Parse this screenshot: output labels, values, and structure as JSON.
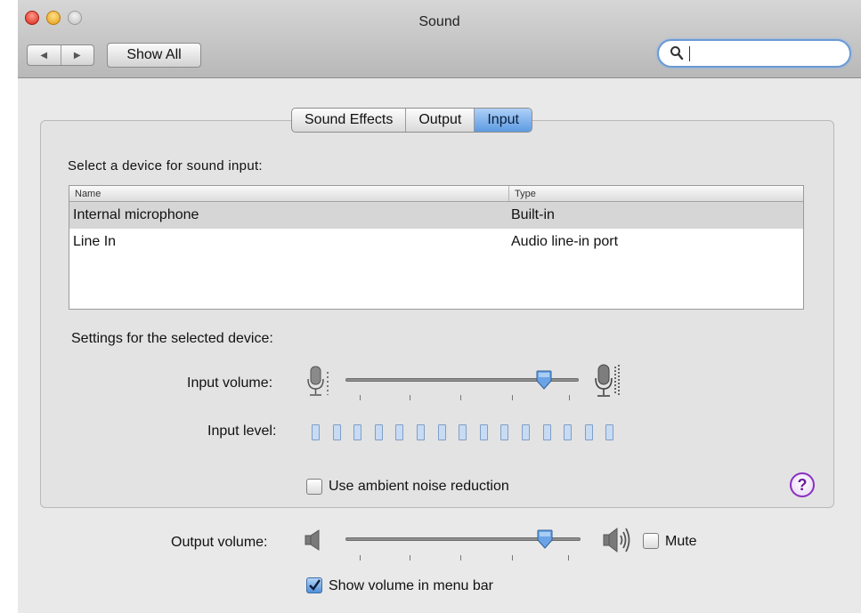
{
  "window": {
    "title": "Sound"
  },
  "toolbar": {
    "back_glyph": "◀",
    "forward_glyph": "▶",
    "show_all_label": "Show All",
    "search_placeholder": ""
  },
  "tabs": [
    {
      "label": "Sound Effects",
      "active": false
    },
    {
      "label": "Output",
      "active": false
    },
    {
      "label": "Input",
      "active": true
    }
  ],
  "input": {
    "device_prompt": "Select a device for sound input:",
    "table": {
      "columns": [
        "Name",
        "Type"
      ],
      "rows": [
        {
          "name": "Internal microphone",
          "type": "Built-in",
          "selected": true
        },
        {
          "name": "Line In",
          "type": "Audio line-in port",
          "selected": false
        }
      ]
    },
    "settings_heading": "Settings for the selected device:",
    "input_volume_label": "Input volume:",
    "input_volume_fraction": 0.85,
    "input_level_label": "Input level:",
    "input_level_segments": 15,
    "noise_reduction_label": "Use ambient noise reduction",
    "noise_reduction_checked": false
  },
  "output": {
    "output_volume_label": "Output volume:",
    "output_volume_fraction": 0.85,
    "mute_label": "Mute",
    "mute_checked": false,
    "show_volume_label": "Show volume in menu bar",
    "show_volume_checked": true
  },
  "help": {
    "glyph": "?"
  },
  "icons": {
    "close": "close-button-icon",
    "minimize": "minimize-button-icon",
    "zoom": "zoom-button-icon",
    "search": "search-icon",
    "mic_low": "microphone-low-icon",
    "mic_high": "microphone-high-icon",
    "speaker_low": "speaker-low-icon",
    "speaker_high": "speaker-high-icon",
    "help": "help-icon"
  },
  "colors": {
    "accent": "#5d9be2",
    "help": "#8a2fc0",
    "close": "#d6241a",
    "minimize": "#e39b12"
  }
}
